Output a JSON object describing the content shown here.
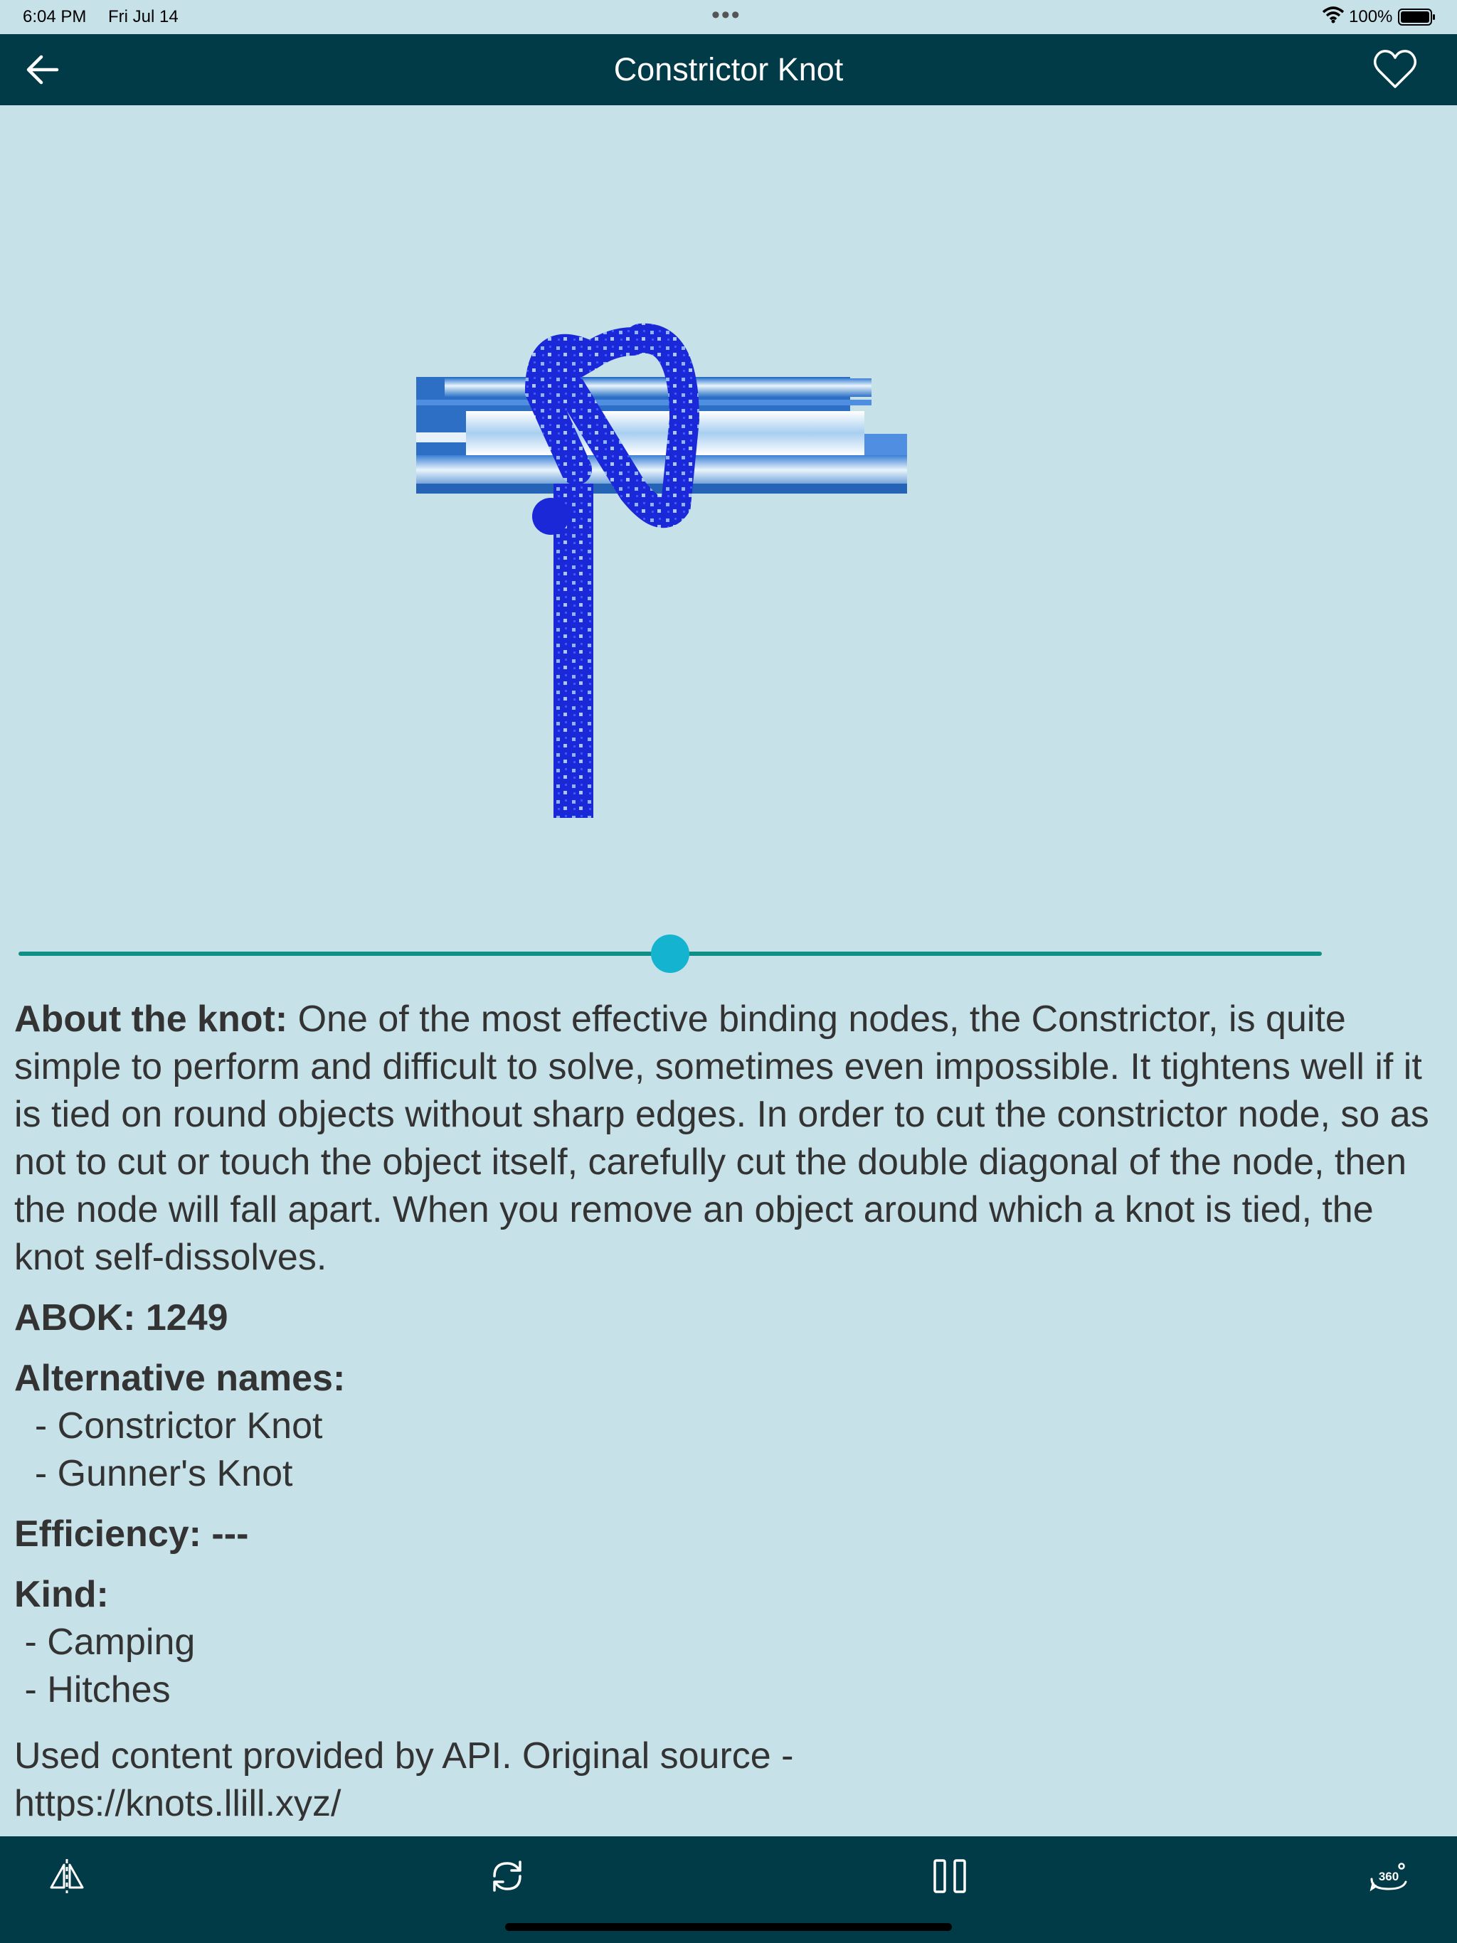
{
  "status_bar": {
    "time": "6:04 PM",
    "date": "Fri Jul 14",
    "battery": "100%"
  },
  "nav": {
    "title": "Constrictor Knot",
    "back_icon": "arrow-left-icon",
    "favorite_icon": "heart-outline-icon"
  },
  "player": {
    "progress": 0.5
  },
  "about": {
    "label": "About the knot:",
    "text": " One of the most effective binding nodes, the Constrictor, is quite simple to perform and difficult to solve, sometimes even impossible. It tightens well if it is tied on round objects without sharp edges. In order to cut the constrictor node, so as not to cut or touch the object itself, carefully cut the double diagonal of the node, then the node will fall apart. When you remove an object around which a knot is tied, the knot self-dissolves."
  },
  "abok": {
    "label": "ABOK:",
    "value": " 1249"
  },
  "alt_names": {
    "label": "Alternative names:",
    "items": [
      "  - Constrictor Knot",
      "  - Gunner's Knot"
    ]
  },
  "efficiency": {
    "label": "Efficiency:",
    "value": " ---"
  },
  "kind": {
    "label": "Kind:",
    "items": [
      " - Camping",
      " - Hitches"
    ]
  },
  "credit": {
    "line1": "Used content provided by API. Original source -",
    "line2": "https://knots.llill.xyz/"
  },
  "toolbar": {
    "icons": [
      "mirror-flip-icon",
      "repeat-icon",
      "pause-icon",
      "rotate-360-icon"
    ]
  },
  "colors": {
    "background": "#c6e1e8",
    "bar": "#003b47",
    "accent": "#14b4d0",
    "track": "#0e9087"
  }
}
